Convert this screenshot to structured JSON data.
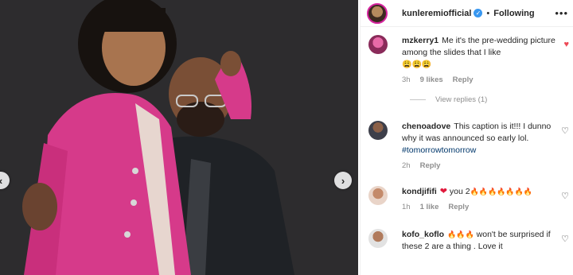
{
  "header": {
    "username": "kunleremiofficial",
    "dot": "•",
    "follow_state": "Following",
    "more": "•••"
  },
  "photo": {
    "prev_arrow": "‹",
    "next_arrow": "›"
  },
  "comments": [
    {
      "username": "mzkerry1",
      "text": "Me it's the pre-wedding picture among the slides that I like",
      "emoji": "😩😩😩",
      "time": "3h",
      "likes": "9 likes",
      "reply": "Reply",
      "liked": true
    },
    {
      "username": "chenoadove",
      "text": "This caption is it!!! I dunno why it was announced so early lol.",
      "hashtag": "#tomorrowtomorrow",
      "time": "2h",
      "reply": "Reply"
    },
    {
      "username": "kondjififi",
      "heart": "❤",
      "text": "you 2",
      "fire": "🔥🔥🔥🔥🔥🔥🔥",
      "time": "1h",
      "likes": "1 like",
      "reply": "Reply"
    },
    {
      "username": "kofo_koflo",
      "fire": "🔥🔥🔥",
      "text": "won't be surprised if these 2 are a thing . Love it"
    }
  ],
  "view_replies": "View replies (1)",
  "colors": {
    "verified": "#3897f0",
    "liked_heart": "#ed4956",
    "blazer_pink": "#d63a8a",
    "background_dark": "#2b2b2d"
  }
}
